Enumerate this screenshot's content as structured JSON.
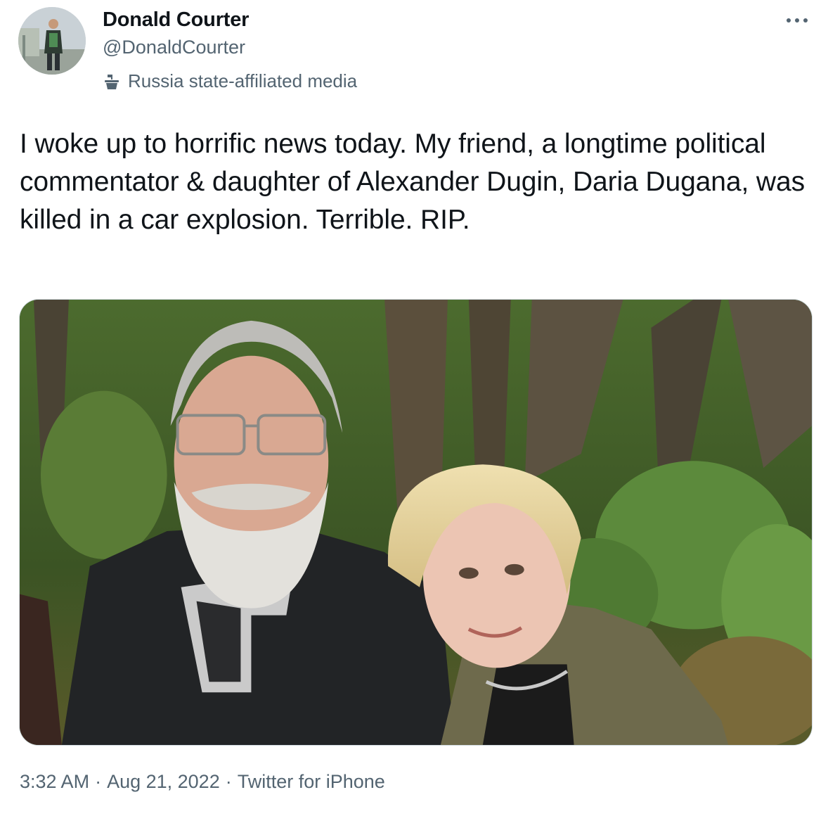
{
  "author": {
    "display_name": "Donald Courter",
    "handle": "@DonaldCourter",
    "affiliation_label": "Russia state-affiliated media",
    "affiliation_icon": "podium-icon"
  },
  "tweet": {
    "text": "I woke up to horrific news today. My friend, a longtime political commentator & daughter of Alexander Dugin, Daria Dugana, was killed in a car explosion. Terrible. RIP."
  },
  "meta": {
    "time": "3:32 AM",
    "separator": "·",
    "date": "Aug 21, 2022",
    "source": "Twitter for iPhone"
  },
  "icons": {
    "more": "more-dots-icon"
  },
  "colors": {
    "text_primary": "#0f1419",
    "text_secondary": "#536471",
    "border": "#cfd9de"
  }
}
